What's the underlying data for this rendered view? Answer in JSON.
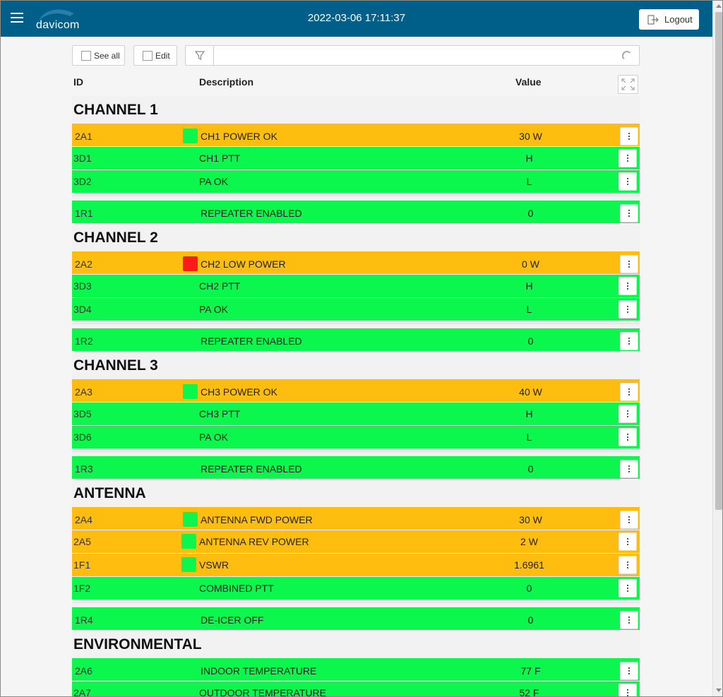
{
  "header": {
    "logo_text": "davicom",
    "datetime": "2022-03-06 17:11:37",
    "logout_label": "Logout"
  },
  "toolbar": {
    "see_all_label": "See all",
    "edit_label": "Edit",
    "filter_value": ""
  },
  "columns": {
    "id": "ID",
    "description": "Description",
    "value": "Value"
  },
  "colors": {
    "header": "#005f89",
    "ok": "#0bf74d",
    "warn": "#ffbe0f",
    "alarm": "#ff1a1a"
  },
  "groups": [
    {
      "title": "CHANNEL 1",
      "rows": [
        {
          "id": "2A1",
          "desc": "CH1 POWER OK",
          "value": "30 W",
          "status": "warn",
          "indicator": "ok"
        },
        {
          "id": "3D1",
          "desc": "CH1 PTT",
          "value": "H",
          "status": "ok"
        },
        {
          "id": "3D2",
          "desc": "PA OK",
          "value": "L",
          "status": "ok"
        }
      ],
      "extra": {
        "id": "1R1",
        "desc": "REPEATER ENABLED",
        "value": "0",
        "status": "ok"
      }
    },
    {
      "title": "CHANNEL 2",
      "rows": [
        {
          "id": "2A2",
          "desc": "CH2 LOW POWER",
          "value": "0 W",
          "status": "warn",
          "indicator": "alarm"
        },
        {
          "id": "3D3",
          "desc": "CH2 PTT",
          "value": "H",
          "status": "ok"
        },
        {
          "id": "3D4",
          "desc": "PA OK",
          "value": "L",
          "status": "ok"
        }
      ],
      "extra": {
        "id": "1R2",
        "desc": "REPEATER ENABLED",
        "value": "0",
        "status": "ok"
      }
    },
    {
      "title": "CHANNEL 3",
      "rows": [
        {
          "id": "2A3",
          "desc": "CH3 POWER OK",
          "value": "40 W",
          "status": "warn",
          "indicator": "ok"
        },
        {
          "id": "3D5",
          "desc": "CH3 PTT",
          "value": "H",
          "status": "ok"
        },
        {
          "id": "3D6",
          "desc": "PA OK",
          "value": "L",
          "status": "ok"
        }
      ],
      "extra": {
        "id": "1R3",
        "desc": "REPEATER ENABLED",
        "value": "0",
        "status": "ok"
      }
    },
    {
      "title": "ANTENNA",
      "rows": [
        {
          "id": "2A4",
          "desc": "ANTENNA FWD POWER",
          "value": "30 W",
          "status": "warn",
          "indicator": "ok"
        },
        {
          "id": "2A5",
          "desc": "ANTENNA REV POWER",
          "value": "2 W",
          "status": "warn",
          "indicator": "ok"
        },
        {
          "id": "1F1",
          "desc": "VSWR",
          "value": "1.6961",
          "status": "warn",
          "indicator": "ok"
        },
        {
          "id": "1F2",
          "desc": "COMBINED PTT",
          "value": "0",
          "status": "ok"
        }
      ],
      "extra": {
        "id": "1R4",
        "desc": "DE-ICER OFF",
        "value": "0",
        "status": "ok"
      }
    },
    {
      "title": "ENVIRONMENTAL",
      "rows": [
        {
          "id": "2A6",
          "desc": "INDOOR TEMPERATURE",
          "value": "77 F",
          "status": "ok"
        },
        {
          "id": "2A7",
          "desc": "OUTDOOR TEMPERATURE",
          "value": "52 F",
          "status": "ok"
        }
      ]
    }
  ]
}
